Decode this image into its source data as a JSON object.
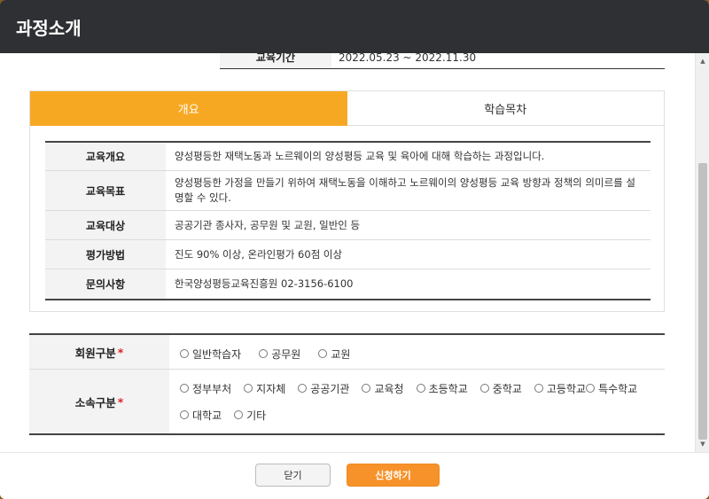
{
  "modal": {
    "title": "과정소개"
  },
  "period": {
    "label": "교육기간",
    "value": "2022.05.23 ~ 2022.11.30"
  },
  "tabs": [
    {
      "label": "개요",
      "active": true
    },
    {
      "label": "학습목차",
      "active": false
    }
  ],
  "info": [
    {
      "label": "교육개요",
      "value": "양성평등한 재택노동과 노르웨이의 양성평등 교육 및 육아에 대해 학습하는 과정입니다."
    },
    {
      "label": "교육목표",
      "value": "양성평등한 가정을 만들기 위하여 재택노동을 이해하고 노르웨이의 양성평등 교육 방향과 정책의 의미르를 설명할 수 있다."
    },
    {
      "label": "교육대상",
      "value": "공공기관 종사자, 공무원 및 교원, 일반인 등"
    },
    {
      "label": "평가방법",
      "value": "진도 90% 이상, 온라인평가 60점 이상"
    },
    {
      "label": "문의사항",
      "value": "한국양성평등교육진흥원 02-3156-6100"
    }
  ],
  "form": {
    "member_type": {
      "label": "회원구분",
      "required_mark": "*",
      "options": [
        "일반학습자",
        "공무원",
        "교원"
      ]
    },
    "affiliation": {
      "label": "소속구분",
      "required_mark": "*",
      "options": [
        "정부부처",
        "지자체",
        "공공기관",
        "교육청",
        "초등학교",
        "중학교",
        "고등학교",
        "특수학교",
        "대학교",
        "기타"
      ]
    }
  },
  "footer": {
    "close_label": "닫기",
    "apply_label": "신청하기"
  },
  "colors": {
    "accent": "#f7a823",
    "header_bg": "#2f3033",
    "apply_button": "#f7922a"
  }
}
